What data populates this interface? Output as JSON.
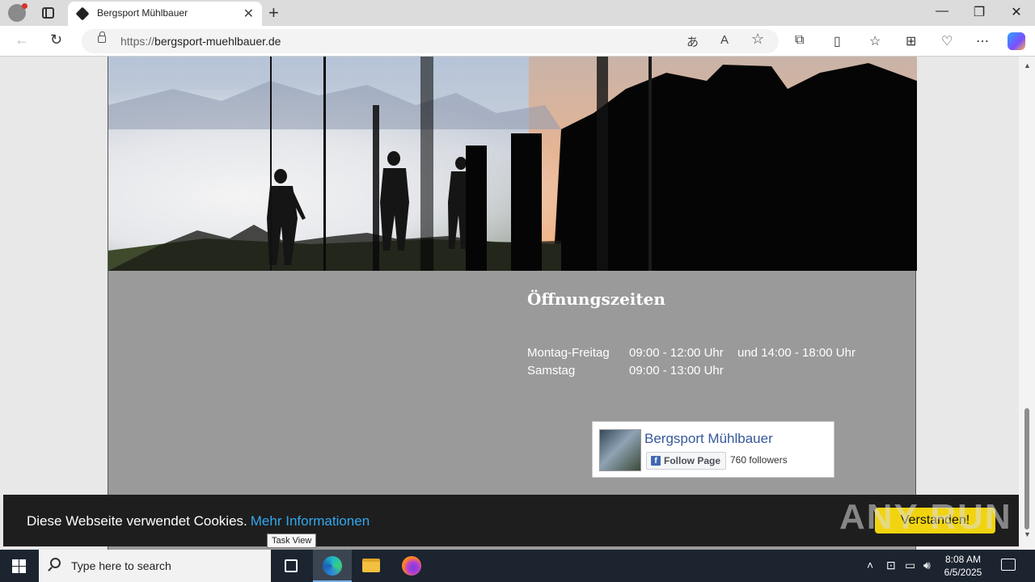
{
  "browser": {
    "tab_title": "Bergsport Mühlbauer",
    "url_prefix": "https://",
    "url_domain": "bergsport-muehlbauer.de",
    "icons": [
      "profile-icon",
      "tab-actions-icon",
      "close-icon",
      "new-tab-icon",
      "minimize-icon",
      "restore-icon",
      "window-close-icon",
      "back-icon",
      "refresh-icon",
      "lock-icon",
      "translate-icon",
      "read-aloud-icon",
      "favorite-star-icon",
      "extensions-icon",
      "split-screen-icon",
      "favorites-icon",
      "collections-icon",
      "browser-essentials-icon",
      "more-icon",
      "copilot-icon"
    ]
  },
  "hours": {
    "title": "Öffnungszeiten",
    "rows": [
      {
        "day": "Montag-Freitag",
        "time": "09:00 - 12:00 Uhr",
        "extra": "und 14:00 - 18:00 Uhr"
      },
      {
        "day": "Samstag",
        "time": "09:00 - 13:00 Uhr",
        "extra": ""
      }
    ]
  },
  "facebook": {
    "page_name": "Bergsport Mühlbauer",
    "follow_label": "Follow Page",
    "followers": "760 followers"
  },
  "cookie_banner": {
    "text": "Diese Webseite verwendet Cookies.",
    "link": "Mehr Informationen",
    "button": "Verstanden!"
  },
  "watermark": "ANY RUN",
  "tooltip": "Task View",
  "taskbar": {
    "search_placeholder": "Type here to search",
    "time": "8:08 AM",
    "date": "6/5/2025"
  },
  "colors": {
    "cookie_link": "#31a8f0",
    "cookie_button": "#f1d40f",
    "facebook_blue": "#365899",
    "site_background": "#9a9a9a"
  }
}
